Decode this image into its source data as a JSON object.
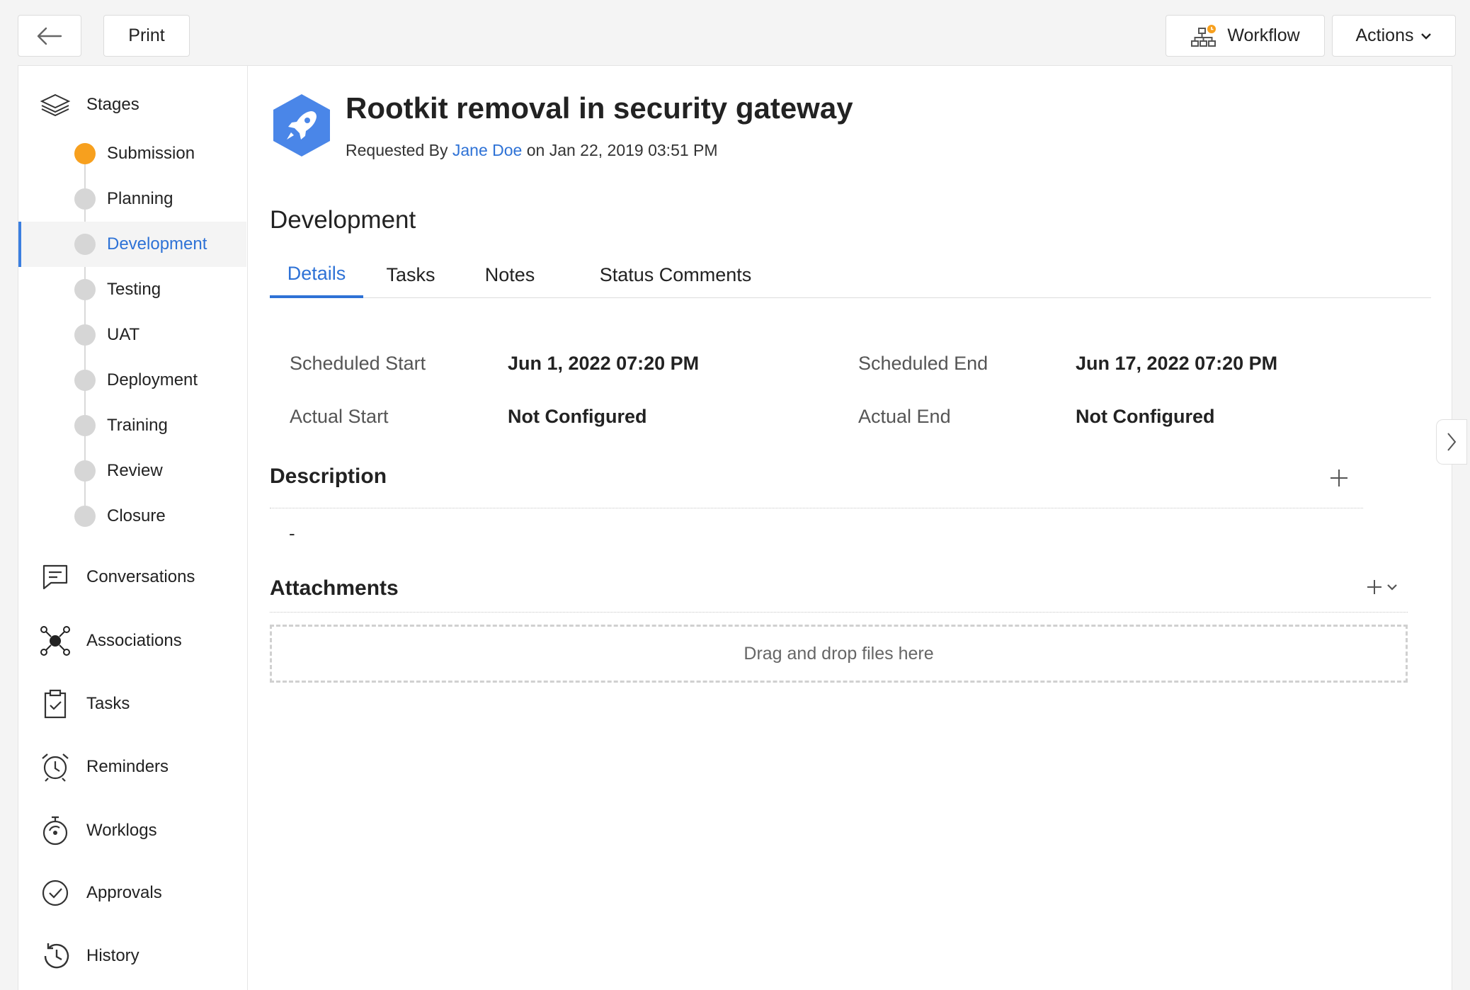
{
  "toolbar": {
    "back_icon": "arrow-left-icon",
    "print_label": "Print",
    "workflow_label": "Workflow",
    "workflow_icon": "workflow-icon",
    "actions_label": "Actions",
    "accent_color": "#f7a01e"
  },
  "sidebar": {
    "stages_label": "Stages",
    "stages": [
      {
        "label": "Submission",
        "state": "current"
      },
      {
        "label": "Planning",
        "state": "pending"
      },
      {
        "label": "Development",
        "state": "selected"
      },
      {
        "label": "Testing",
        "state": "pending"
      },
      {
        "label": "UAT",
        "state": "pending"
      },
      {
        "label": "Deployment",
        "state": "pending"
      },
      {
        "label": "Training",
        "state": "pending"
      },
      {
        "label": "Review",
        "state": "pending"
      },
      {
        "label": "Closure",
        "state": "pending"
      }
    ],
    "sections": [
      {
        "label": "Conversations",
        "icon": "conversation-icon"
      },
      {
        "label": "Associations",
        "icon": "associations-icon"
      },
      {
        "label": "Tasks",
        "icon": "clipboard-check-icon"
      },
      {
        "label": "Reminders",
        "icon": "alarm-clock-icon"
      },
      {
        "label": "Worklogs",
        "icon": "stopwatch-icon"
      },
      {
        "label": "Approvals",
        "icon": "check-circle-icon"
      },
      {
        "label": "History",
        "icon": "history-icon"
      }
    ]
  },
  "header": {
    "title": "Rootkit removal in security gateway",
    "requested_by_prefix": "Requested By",
    "requester": "Jane Doe",
    "requested_on": "on Jan 22, 2019 03:51 PM",
    "icon": "rocket-icon",
    "icon_color": "#4a86e8"
  },
  "stage_view": {
    "title": "Development",
    "tabs": [
      {
        "label": "Details",
        "active": true
      },
      {
        "label": "Tasks",
        "active": false
      },
      {
        "label": "Notes",
        "active": false
      },
      {
        "label": "Status Comments",
        "active": false
      }
    ],
    "fields": {
      "scheduled_start_label": "Scheduled Start",
      "scheduled_start_value": "Jun 1, 2022 07:20 PM",
      "scheduled_end_label": "Scheduled End",
      "scheduled_end_value": "Jun 17, 2022 07:20 PM",
      "actual_start_label": "Actual Start",
      "actual_start_value": "Not Configured",
      "actual_end_label": "Actual End",
      "actual_end_value": "Not Configured"
    },
    "description": {
      "title": "Description",
      "value": "-"
    },
    "attachments": {
      "title": "Attachments",
      "dropzone_text": "Drag and drop files here"
    }
  }
}
